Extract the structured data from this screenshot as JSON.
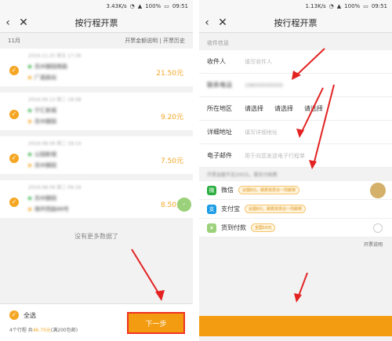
{
  "left": {
    "status": {
      "speed": "3.43K/s",
      "battery": "100%",
      "time": "09:51"
    },
    "nav": {
      "back_icon": "‹",
      "close_icon": "✕",
      "title": "按行程开票"
    },
    "subhead": {
      "month": "11月",
      "links": "开票金额说明 | 开票历史"
    },
    "trips": [
      {
        "date": "2016.11.25 周五 17:39",
        "from": "苏州御园南路",
        "to": "广昌路站",
        "price": "21.50元"
      },
      {
        "date": "2016.09.13 周二 18:08",
        "from": "宁汇新城",
        "to": "苏州御园",
        "price": "9.20元"
      },
      {
        "date": "2016.08.09 周二 18:14",
        "from": "公园新城",
        "to": "苏州御园",
        "price": "7.50元"
      },
      {
        "date": "2016.08.09 周二 09:16",
        "from": "苏州御园",
        "to": "南环西路88号",
        "price": "8.50元"
      }
    ],
    "no_more": "没有更多数据了",
    "select_all": "全选",
    "summary_pre": "4个行程 共",
    "summary_amount": "46.70元",
    "summary_post": "(满200包邮)",
    "next_button": "下一步"
  },
  "right": {
    "status": {
      "speed": "1.13K/s",
      "battery": "100%",
      "time": "09:51"
    },
    "nav": {
      "back_icon": "‹",
      "close_icon": "✕",
      "title": "按行程开票"
    },
    "section": "收件信息",
    "recipient_label": "收件人",
    "recipient_placeholder": "填写收件人",
    "phone_label": "联系电话",
    "phone_value": "18600000000",
    "region_label": "所在地区",
    "region_options": [
      "请选择",
      "请选择",
      "请选择"
    ],
    "address_label": "详细地址",
    "address_placeholder": "填写详细地址",
    "email_label": "电子邮件",
    "email_placeholder": "用于向您发送电子行程单",
    "notice": "开票金额不足200元，需支付邮费",
    "payments": [
      {
        "icon": "微",
        "color": "#2aae3f",
        "label": "微信",
        "tag": "全国8元，邮费发票合一同邮寄"
      },
      {
        "icon": "支",
        "color": "#1a9be6",
        "label": "支付宝",
        "tag": "全国8元，邮费发票合一同邮寄"
      },
      {
        "icon": "¥",
        "color": "#9bd17a",
        "label": "货到付款",
        "tag": "全国10元"
      }
    ],
    "invoice_note": "开票说明"
  },
  "colors": {
    "accent": "#f39c12",
    "arrow": "#e32222"
  }
}
